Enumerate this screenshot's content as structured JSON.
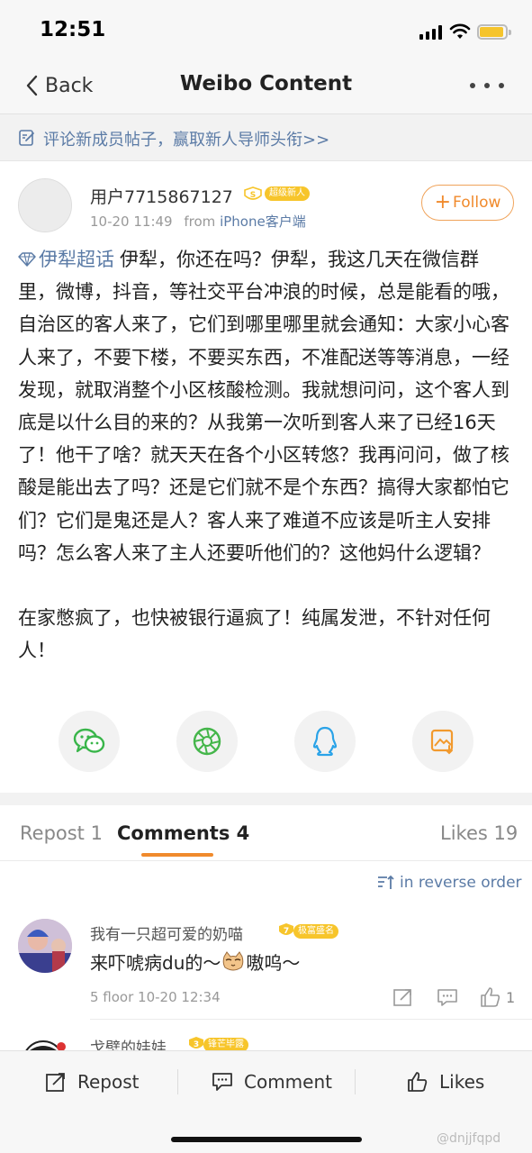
{
  "status_bar": {
    "time": "12:51"
  },
  "nav": {
    "back_label": "Back",
    "title": "Weibo Content"
  },
  "banner": {
    "text": "评论新成员帖子，赢取新人导师头衔>>"
  },
  "post": {
    "username": "用户7715867127",
    "badge": "超级新人",
    "time": "10-20 11:49",
    "from_label": "from",
    "source": "iPhone客户端",
    "follow_label": "Follow",
    "topic": "伊犁超话",
    "paragraph1": "伊犁，你还在吗？伊犁，我这几天在微信群里，微博，抖音，等社交平台冲浪的时候，总是能看的哦，自治区的客人来了，它们到哪里哪里就会通知：大家小心客人来了，不要下楼，不要买东西，不准配送等等消息，一经发现，就取消整个小区核酸检测。我就想问问，这个客人到底是以什么目的来的？从我第一次听到客人来了已经16天了！他干了啥？就天天在各个小区转悠？我再问问，做了核酸是能出去了吗？还是它们就不是个东西？搞得大家都怕它们？它们是鬼还是人？客人来了难道不应该是听主人安排吗？怎么客人来了主人还要听他们的？这他妈什么逻辑？",
    "paragraph2": "在家憋疯了，也快被银行逼疯了！纯属发泄，不针对任何人！"
  },
  "share_icons": [
    "wechat-icon",
    "moments-icon",
    "qq-icon",
    "save-image-icon"
  ],
  "tabs": {
    "repost": "Repost 1",
    "comments": "Comments 4",
    "likes": "Likes 19"
  },
  "order_label": "in reverse order",
  "comments": [
    {
      "name": "我有一只超可爱的奶喵",
      "badge": "极富盛名",
      "badge_level": "7",
      "text_before": "来吓唬病du的～",
      "text_after": "嗷呜～",
      "meta": "5 floor 10-20 12:34",
      "likes": "1"
    },
    {
      "name": "戈壁的娃娃",
      "badge": "锋芒毕露",
      "badge_level": "3"
    }
  ],
  "toolbar": {
    "repost": "Repost",
    "comment": "Comment",
    "likes": "Likes"
  },
  "watermark": "@dnjjfqpd",
  "colors": {
    "accent": "#f08a2c",
    "link": "#5b7ba6",
    "badge": "#f7c52b"
  }
}
